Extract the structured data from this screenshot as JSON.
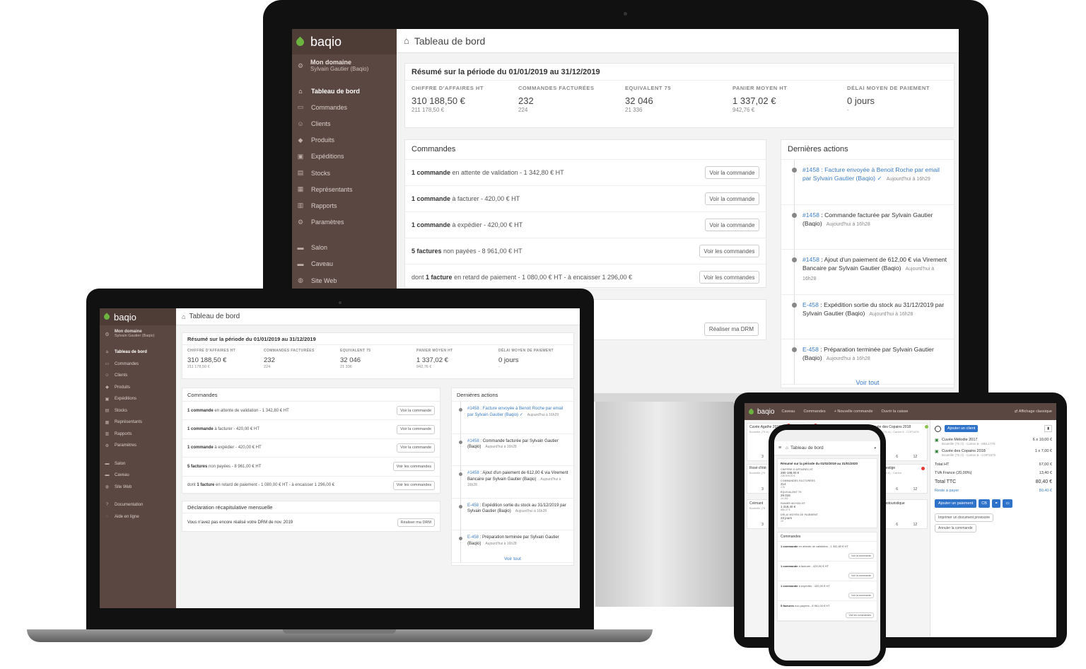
{
  "brand": "baqio",
  "page_title": "Tableau de bord",
  "account": {
    "name": "Mon domaine",
    "user": "Sylvain Gautier (Baqio)"
  },
  "nav": [
    {
      "label": "Tableau de bord",
      "icon": "home-icon"
    },
    {
      "label": "Commandes",
      "icon": "inbox-icon"
    },
    {
      "label": "Clients",
      "icon": "users-icon"
    },
    {
      "label": "Produits",
      "icon": "tag-icon"
    },
    {
      "label": "Expéditions",
      "icon": "truck-icon"
    },
    {
      "label": "Stocks",
      "icon": "box-icon"
    },
    {
      "label": "Représentants",
      "icon": "briefcase-icon"
    },
    {
      "label": "Rapports",
      "icon": "chart-icon"
    },
    {
      "label": "Paramètres",
      "icon": "gear-icon"
    }
  ],
  "nav_secondary": [
    {
      "label": "Salon",
      "icon": "store-icon"
    },
    {
      "label": "Caveau",
      "icon": "store-icon"
    },
    {
      "label": "Site Web",
      "icon": "globe-icon"
    }
  ],
  "nav_help": [
    {
      "label": "Documentation",
      "icon": "help-icon"
    },
    {
      "label": "Aide en ligne",
      "icon": "chat-icon"
    }
  ],
  "summary": {
    "title": "Résumé sur la période du 01/01/2019 au 31/12/2019",
    "stats": [
      {
        "label": "CHIFFRE D'AFFAIRES HT",
        "value": "310 188,50 €",
        "sub": "211 178,50 €"
      },
      {
        "label": "COMMANDES FACTURÉES",
        "value": "232",
        "sub": "224"
      },
      {
        "label": "EQUIVALENT 75",
        "value": "32 046",
        "sub": "21 336"
      },
      {
        "label": "PANIER MOYEN HT",
        "value": "1 337,02 €",
        "sub": "942,76 €"
      },
      {
        "label": "DÉLAI MOYEN DE PAIEMENT",
        "value": "0 jours",
        "sub": "-"
      }
    ]
  },
  "orders": {
    "title": "Commandes",
    "rows": [
      {
        "bold": "1 commande",
        "text": " en attente de validation - 1 342,80 € HT",
        "button": "Voir la commande"
      },
      {
        "bold": "1 commande",
        "text": " à facturer - 420,00 € HT",
        "button": "Voir la commande"
      },
      {
        "bold": "1 commande",
        "text": " à expédier - 420,00 € HT",
        "button": "Voir la commande"
      },
      {
        "bold": "5 factures",
        "text": " non payées - 8 961,00 € HT",
        "button": "Voir les commandes"
      },
      {
        "pre": "dont ",
        "bold": "1 facture",
        "text": " en retard de paiement - 1 080,00 € HT - à encaisser 1 296,00 €",
        "button": "Voir les commandes"
      }
    ]
  },
  "drm": {
    "title": "Déclaration récapitulative mensuelle",
    "text": "Vous n'avez pas encore réalisé votre DRM de nov. 2019",
    "button": "Réaliser ma DRM"
  },
  "actions": {
    "title": "Dernières actions",
    "items": [
      {
        "ref": "#1458",
        "text": " : Facture envoyée à Benoit Roche par email par Sylvain Gautier (Baqio) ✓",
        "time": "Aujourd'hui à 16h29"
      },
      {
        "ref": "#1458",
        "text": " : Commande facturée par Sylvain Gautier (Baqio)",
        "time": "Aujourd'hui à 16h28"
      },
      {
        "ref": "#1458",
        "text": " : Ajout d'un paiement de 612,00 € via Virement Bancaire par Sylvain Gautier (Baqio)",
        "time": "Aujourd'hui à 16h28"
      },
      {
        "ref": "E-458",
        "text": " : Expédition sortie du stock au 31/12/2019 par Sylvain Gautier (Baqio)",
        "time": "Aujourd'hui à 16h28"
      },
      {
        "ref": "E-458",
        "text": " : Préparation terminée par Sylvain Gautier (Baqio)",
        "time": "Aujourd'hui à 16h28"
      }
    ],
    "see_all": "Voir tout"
  },
  "tablet": {
    "nav": [
      "Caveau",
      "Commandes",
      "+ Nouvelle commande",
      "Ouvrir la caisse"
    ],
    "classic": "Affichage classique",
    "products": [
      {
        "name": "Cuvée Agathe 2018",
        "desc": "Bouteille (75 cl)",
        "nums": [
          "3",
          "6"
        ]
      },
      {
        "name": "Rosé d'été",
        "desc": "Bouteille (75",
        "nums": [
          "3",
          "6"
        ]
      },
      {
        "name": "Crémant",
        "desc": "Bouteille (75",
        "nums": [
          "3",
          "6"
        ]
      },
      {
        "name": "Cuvée des Copains 2018",
        "desc": "Bouteille (75 cl) - Carton 6 - COP1875",
        "nums": [
          "3",
          "6",
          "12"
        ]
      },
      {
        "name": "Cuvée Prestige",
        "desc": "Bouteille (75 cl) - Carton",
        "nums": [
          "3",
          "6",
          "12"
        ]
      },
      {
        "name": "Visite oenotouristique",
        "desc": "",
        "nums": [
          "3",
          "6",
          "12"
        ]
      }
    ],
    "add_client": "Ajouter un client",
    "lines": [
      {
        "name": "Cuvée Mélodie 2017",
        "desc": "Bouteille (75 cl) - Carton 6 - MEL1775",
        "qty": "6 x 10,00 €"
      },
      {
        "name": "Cuvée des Copains 2018",
        "desc": "Bouteille (75 cl) - Carton 6 - COP1875",
        "qty": "1 x 7,00 €"
      }
    ],
    "totals": [
      {
        "label": "Total HT",
        "value": "67,00 €"
      },
      {
        "label": "TVA France (20,00%)",
        "value": "13,40 €"
      },
      {
        "label": "Total TTC",
        "value": "80,40 €"
      },
      {
        "label": "Reste à payer",
        "value": "80,40 €"
      }
    ],
    "pay_button": "Ajouter un paiement",
    "cb": "CB",
    "print": "Imprimer un document provisoire",
    "cancel": "Annuler la commande"
  },
  "phone": {
    "title": "Tableau de bord",
    "summary": "Résumé sur la période du 01/02/2019 au 31/01/2020",
    "stats": [
      {
        "label": "CHIFFRE D'AFFAIRES HT",
        "value": "280 198,00 €",
        "sub": "238 849,00 €"
      },
      {
        "label": "COMMANDES FACTURÉES",
        "value": "214",
        "sub": "276"
      },
      {
        "label": "EQUIVALENT 75",
        "value": "29 016",
        "sub": "24 252"
      },
      {
        "label": "PANIER MOYEN HT",
        "value": "1 318,40 €",
        "sub": "866,37 €"
      },
      {
        "label": "DÉLAI MOYEN DE PAIEMENT",
        "value": "23 jours",
        "sub": "29"
      }
    ],
    "orders_title": "Commandes",
    "orders": [
      {
        "bold": "1 commande",
        "text": " en attente de validation - 1 342,80 € HT",
        "button": "Voir la commande"
      },
      {
        "bold": "1 commande",
        "text": " à facturer - 420,00 € HT",
        "button": "Voir la commande"
      },
      {
        "bold": "1 commande",
        "text": " à expédier - 420,00 € HT",
        "button": "Voir la commande"
      },
      {
        "bold": "5 factures",
        "text": " non payées - 8 961,00 € HT",
        "button": "Voir les commandes"
      }
    ]
  }
}
